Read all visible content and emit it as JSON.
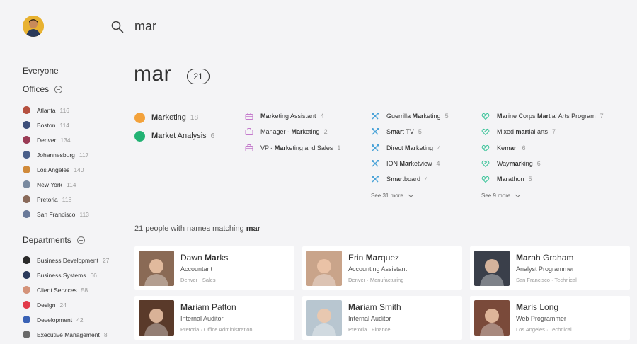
{
  "search": {
    "query": "mar"
  },
  "title": "mar",
  "total": "21",
  "sidebar": {
    "everyone": "Everyone",
    "offices_label": "Offices",
    "offices": [
      {
        "name": "Atlanta",
        "count": "116",
        "color": "#b5503f"
      },
      {
        "name": "Boston",
        "count": "114",
        "color": "#3d4f7a"
      },
      {
        "name": "Denver",
        "count": "134",
        "color": "#9a3b55"
      },
      {
        "name": "Johannesburg",
        "count": "117",
        "color": "#4a5f8a"
      },
      {
        "name": "Los Angeles",
        "count": "140",
        "color": "#d08a3a"
      },
      {
        "name": "New York",
        "count": "114",
        "color": "#7a8aa0"
      },
      {
        "name": "Pretoria",
        "count": "118",
        "color": "#8a6a5a"
      },
      {
        "name": "San Francisco",
        "count": "113",
        "color": "#6a7a9a"
      }
    ],
    "departments_label": "Departments",
    "departments": [
      {
        "name": "Business Development",
        "count": "27",
        "color": "#2a2a2a"
      },
      {
        "name": "Business Systems",
        "count": "66",
        "color": "#2b3a5c"
      },
      {
        "name": "Client Services",
        "count": "58",
        "color": "#d4937a"
      },
      {
        "name": "Design",
        "count": "24",
        "color": "#e23a4a"
      },
      {
        "name": "Development",
        "count": "42",
        "color": "#3a62b5"
      },
      {
        "name": "Executive Management",
        "count": "8",
        "color": "#6a6a6a"
      }
    ]
  },
  "groups": [
    {
      "pre": "",
      "hl": "Mar",
      "post": "keting",
      "count": "18",
      "color": "#f3a23b"
    },
    {
      "pre": "",
      "hl": "Mar",
      "post": "ket Analysis",
      "count": "6",
      "color": "#22b273"
    }
  ],
  "titles": [
    {
      "pre": "",
      "hl": "Mar",
      "post": "keting Assistant",
      "count": "4"
    },
    {
      "pre": "Manager - ",
      "hl": "Mar",
      "post": "keting",
      "count": "2"
    },
    {
      "pre": "VP - ",
      "hl": "Mar",
      "post": "keting and Sales",
      "count": "1"
    }
  ],
  "skills": [
    {
      "pre": "Guerrilla ",
      "hl": "Mar",
      "post": "keting",
      "count": "5"
    },
    {
      "pre": "S",
      "hl": "mar",
      "post": "t TV",
      "count": "5"
    },
    {
      "pre": "Direct ",
      "hl": "Mar",
      "post": "keting",
      "count": "4"
    },
    {
      "pre": "ION ",
      "hl": "Mar",
      "post": "ketview",
      "count": "4"
    },
    {
      "pre": "S",
      "hl": "mar",
      "post": "tboard",
      "count": "4"
    }
  ],
  "skills_more": "See 31 more",
  "interests": [
    {
      "pre": "",
      "hl": "Mar",
      "post": "ine Corps ",
      "hl2": "Mar",
      "post2": "tial Arts Program",
      "count": "7"
    },
    {
      "pre": "Mixed ",
      "hl": "mar",
      "post": "tial arts",
      "count": "7"
    },
    {
      "pre": "Ke",
      "hl": "mar",
      "post": "i",
      "count": "6"
    },
    {
      "pre": "Way",
      "hl": "mar",
      "post": "king",
      "count": "6"
    },
    {
      "pre": "",
      "hl": "Mar",
      "post": "athon",
      "count": "5"
    }
  ],
  "interests_more": "See 9 more",
  "people_head": {
    "text": "21 people with names matching ",
    "term": "mar"
  },
  "people": [
    {
      "first": "Dawn ",
      "hl": "Mar",
      "rest": "ks",
      "title": "Accountant",
      "loc": "Denver · Sales",
      "bg": "#8a6a55"
    },
    {
      "first": "Erin ",
      "hl": "Mar",
      "rest": "quez",
      "title": "Accounting Assistant",
      "loc": "Denver · Manufacturing",
      "bg": "#c9a48a"
    },
    {
      "first": "",
      "hl": "Mar",
      "rest": "ah Graham",
      "title": "Analyst Programmer",
      "loc": "San Francisco · Technical",
      "bg": "#3a3f4a"
    },
    {
      "first": "",
      "hl": "Mar",
      "rest": "iam Patton",
      "title": "Internal Auditor",
      "loc": "Pretoria · Office Administration",
      "bg": "#5a3a2a"
    },
    {
      "first": "",
      "hl": "Mar",
      "rest": "iam Smith",
      "title": "Internal Auditor",
      "loc": "Pretoria · Finance",
      "bg": "#b8c6d0"
    },
    {
      "first": "",
      "hl": "Mar",
      "rest": "is Long",
      "title": "Web Programmer",
      "loc": "Los Angeles · Technical",
      "bg": "#7a4a3a"
    }
  ]
}
